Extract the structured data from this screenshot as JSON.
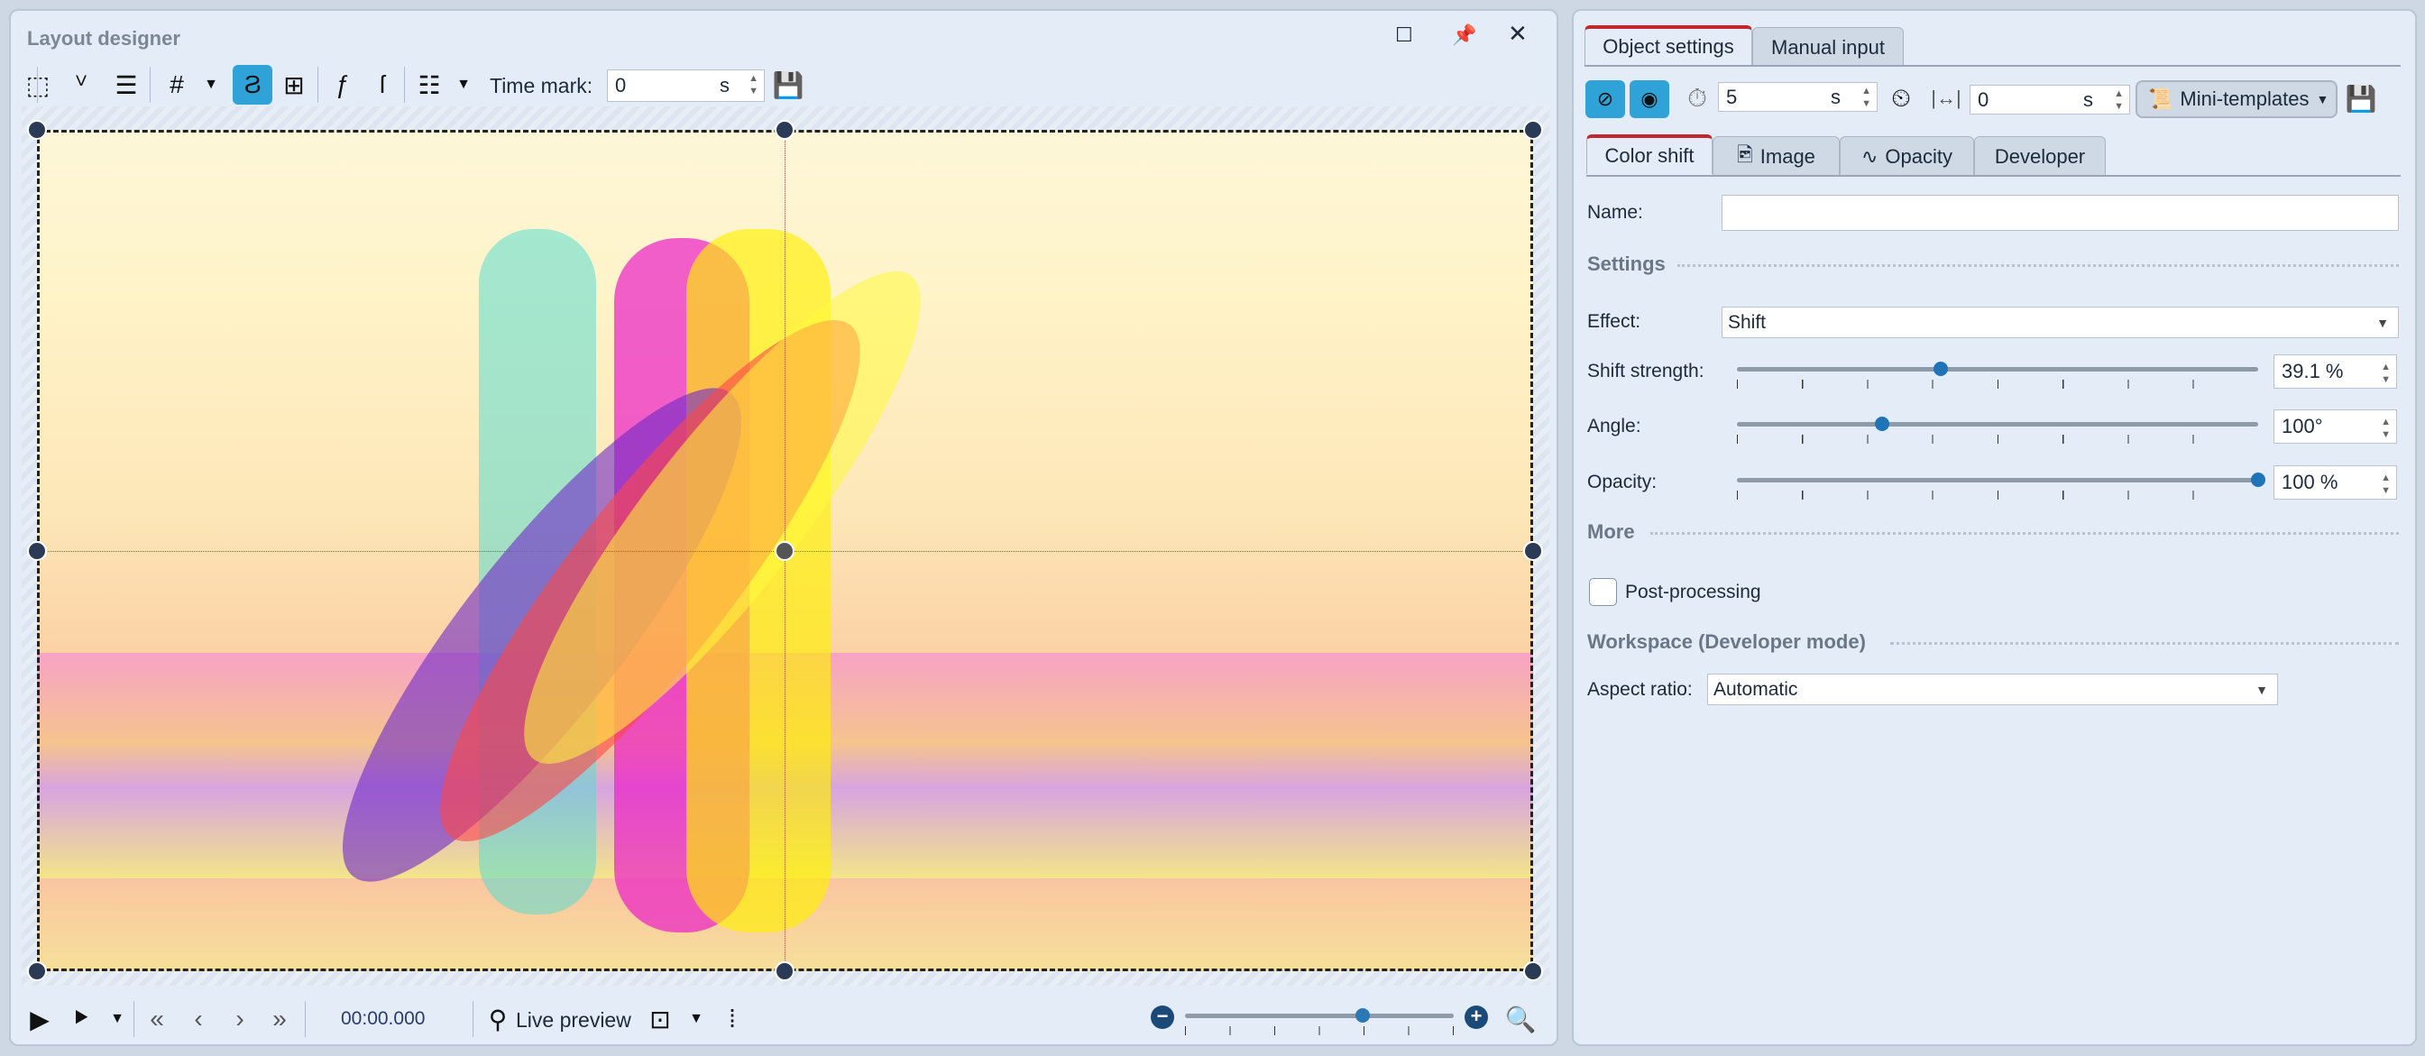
{
  "left_panel": {
    "title": "Layout designer",
    "time_mark_label": "Time mark:",
    "time_mark_value": "0",
    "time_unit": "s",
    "playback_time": "00:00.000",
    "live_preview_label": "Live preview",
    "zoom_level": 0.66
  },
  "right_panel": {
    "tabs": [
      {
        "label": "Object settings",
        "active": true
      },
      {
        "label": "Manual input",
        "active": false
      }
    ],
    "duration_value": "5",
    "duration_unit": "s",
    "offset_value": "0",
    "offset_unit": "s",
    "mini_templates_label": "Mini-templates",
    "sub_tabs": [
      {
        "label": "Color shift",
        "active": true
      },
      {
        "label": "Image"
      },
      {
        "label": "Opacity"
      },
      {
        "label": "Developer"
      }
    ],
    "name_label": "Name:",
    "name_value": "",
    "settings_header": "Settings",
    "effect_label": "Effect:",
    "effect_value": "Shift",
    "shift_strength_label": "Shift strength:",
    "shift_strength_value": "39.1 %",
    "shift_strength_fraction": 0.391,
    "angle_label": "Angle:",
    "angle_value": "100°",
    "angle_fraction": 0.278,
    "opacity_label": "Opacity:",
    "opacity_value": "100 %",
    "opacity_fraction": 1.0,
    "more_header": "More",
    "post_processing_label": "Post-processing",
    "post_processing_checked": false,
    "workspace_header": "Workspace (Developer mode)",
    "aspect_ratio_label": "Aspect ratio:",
    "aspect_ratio_value": "Automatic"
  },
  "colors": {
    "accent": "#2fa3d8",
    "active_tab": "#c0282e",
    "slider_thumb": "#1f74b8"
  }
}
